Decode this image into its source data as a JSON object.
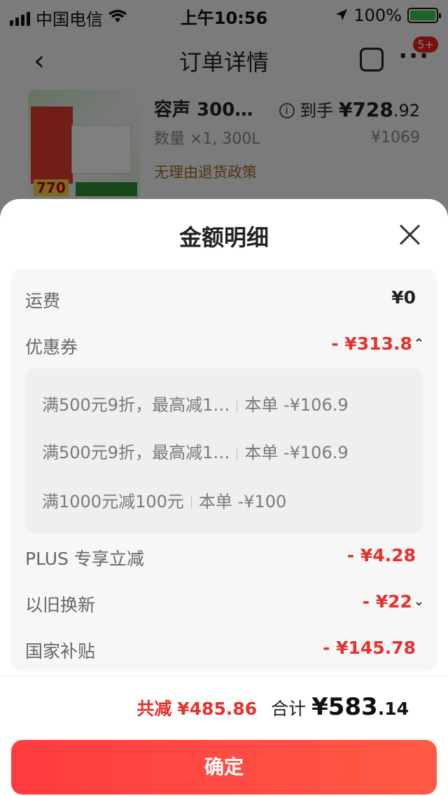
{
  "status_bar": {
    "carrier": "中国电信",
    "time": "上午10:56",
    "battery": "100%"
  },
  "nav": {
    "back_icon": "chevron-left-icon",
    "title": "订单详情",
    "badge": "5+"
  },
  "product": {
    "name": "容声 300…",
    "quantity": "数量 ×1, 300L",
    "policy": "无理由退货政策",
    "hand_label": "到手",
    "hand_price": "¥728",
    "hand_price_decimal": ".92",
    "original_price": "¥1069",
    "thumb_price": "770"
  },
  "sheet": {
    "title": "金额明细",
    "rows": {
      "shipping": {
        "label": "运费",
        "value": "¥0"
      },
      "coupon": {
        "label": "优惠券",
        "value": "- ¥313.8"
      },
      "plus": {
        "label": "PLUS 专享立减",
        "value": "- ¥4.28"
      },
      "tradein": {
        "label": "以旧换新",
        "value": "- ¥22"
      },
      "subsidy": {
        "label": "国家补贴",
        "value": "- ¥145.78"
      }
    },
    "coupons": [
      {
        "desc": "满500元9折，最高减1…",
        "amount": "本单 -¥106.9"
      },
      {
        "desc": "满500元9折，最高减1…",
        "amount": "本单 -¥106.9"
      },
      {
        "desc": "满1000元减100元",
        "amount": "本单 -¥100"
      }
    ]
  },
  "footer": {
    "saved_label": "共减",
    "saved_value": "¥485.86",
    "total_label": "合计",
    "total_main": "¥583",
    "total_decimal": ".14"
  },
  "confirm_label": "确定",
  "colors": {
    "accent": "#e5322d",
    "button": "#ff3b3f"
  }
}
